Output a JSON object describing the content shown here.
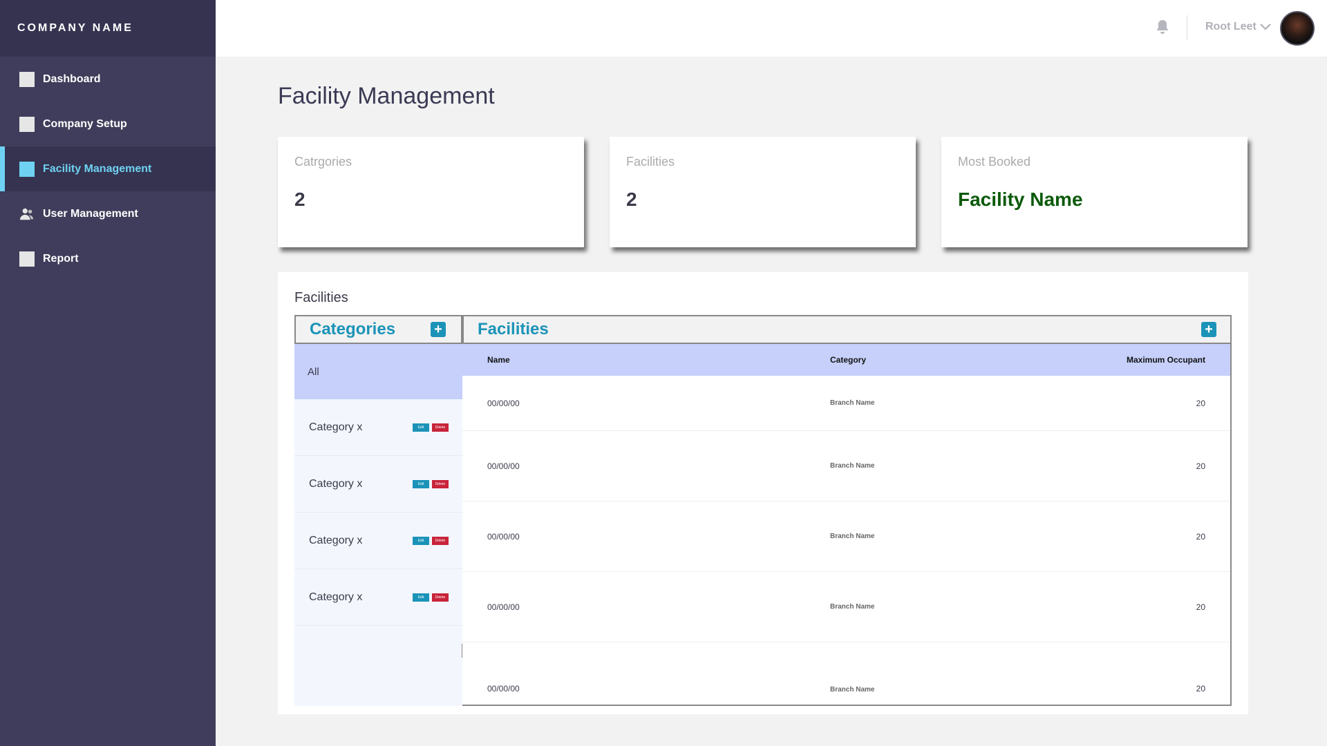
{
  "brand": {
    "name": "COMPANY NAME"
  },
  "sidebar": {
    "items": [
      {
        "label": "Dashboard",
        "icon": "square-icon",
        "active": false
      },
      {
        "label": "Company Setup",
        "icon": "square-icon",
        "active": false
      },
      {
        "label": "Facility Management",
        "icon": "square-icon",
        "active": true
      },
      {
        "label": "User Management",
        "icon": "user-group-icon",
        "active": false
      },
      {
        "label": "Report",
        "icon": "square-icon",
        "active": false
      }
    ]
  },
  "topbar": {
    "user_name": "Root Leet",
    "icons": [
      "bell-icon",
      "chevron-down-icon",
      "avatar"
    ]
  },
  "page": {
    "title": "Facility Management"
  },
  "stats": [
    {
      "label": "Catrgories",
      "value": "2"
    },
    {
      "label": "Facilities",
      "value": "2"
    },
    {
      "label": "Most Booked",
      "value": "Facility Name"
    }
  ],
  "panel": {
    "title": "Facilities",
    "categories": {
      "title": "Categories",
      "all_label": "All",
      "items": [
        {
          "name": "Category x",
          "edit": "Edit",
          "delete": "Delete"
        },
        {
          "name": "Category x",
          "edit": "Edit",
          "delete": "Delete"
        },
        {
          "name": "Category x",
          "edit": "Edit",
          "delete": "Delete"
        },
        {
          "name": "Category x",
          "edit": "Edit",
          "delete": "Delete"
        }
      ]
    },
    "facilities": {
      "title": "Facilities",
      "columns": [
        "Name",
        "Category",
        "Maximum Occupant"
      ],
      "rows": [
        {
          "name": "00/00/00",
          "category": "Branch Name",
          "max": "20"
        },
        {
          "name": "00/00/00",
          "category": "Branch Name",
          "max": "20"
        },
        {
          "name": "00/00/00",
          "category": "Branch Name",
          "max": "20"
        },
        {
          "name": "00/00/00",
          "category": "Branch Name",
          "max": "20"
        },
        {
          "name": "00/00/00",
          "category": "Branch Name",
          "max": "20"
        }
      ]
    }
  },
  "colors": {
    "sidebar_bg": "#3f3d5b",
    "accent": "#6fd2f2",
    "primary": "#1b93b8",
    "danger": "#c8243a",
    "highlight": "#c6d0fb",
    "most_booked": "#0a5a0a"
  }
}
